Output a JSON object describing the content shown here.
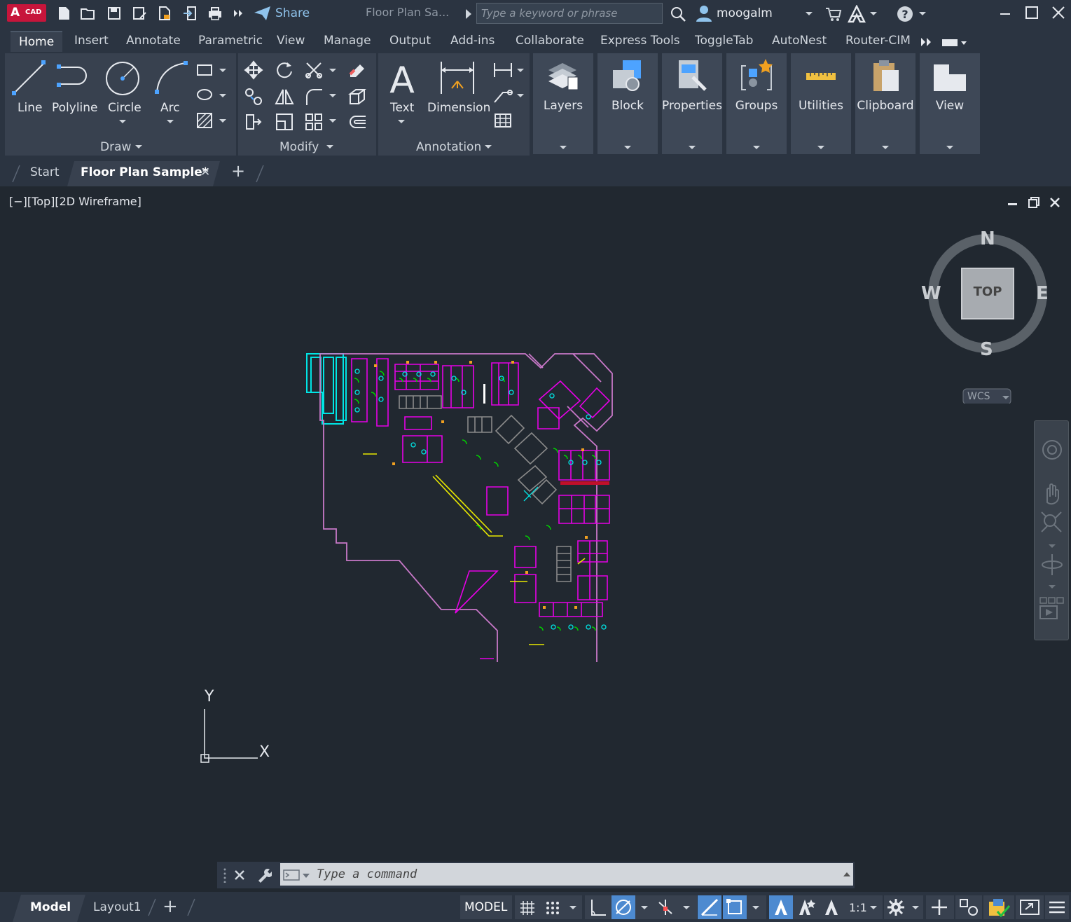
{
  "app": {
    "logo_letter": "A",
    "logo_sub": "CAD"
  },
  "titlebar": {
    "share_label": "Share",
    "document_title": "Floor Plan Sa...",
    "search_placeholder": "Type a keyword or phrase",
    "username": "moogalm"
  },
  "ribbon_tabs": [
    "Home",
    "Insert",
    "Annotate",
    "Parametric",
    "View",
    "Manage",
    "Output",
    "Add-ins",
    "Collaborate",
    "Express Tools",
    "ToggleTab",
    "AutoNest",
    "Router-CIM"
  ],
  "ribbon": {
    "draw": {
      "line": "Line",
      "polyline": "Polyline",
      "circle": "Circle",
      "arc": "Arc",
      "title": "Draw"
    },
    "modify": {
      "title": "Modify"
    },
    "annotation": {
      "text": "Text",
      "dimension": "Dimension",
      "title": "Annotation"
    },
    "big": [
      "Layers",
      "Block",
      "Properties",
      "Groups",
      "Utilities",
      "Clipboard",
      "View"
    ]
  },
  "file_tabs": {
    "start": "Start",
    "active": "Floor Plan Sample*",
    "close": "✕",
    "add": "+"
  },
  "viewport": {
    "label": "[−][Top][2D Wireframe]",
    "viewcube": {
      "n": "N",
      "s": "S",
      "e": "E",
      "w": "W",
      "face": "TOP",
      "wcs": "WCS"
    },
    "ucs": {
      "x": "X",
      "y": "Y"
    }
  },
  "command": {
    "placeholder": "Type a command"
  },
  "layout_tabs": {
    "model": "Model",
    "layout1": "Layout1",
    "add": "+"
  },
  "status": {
    "model": "MODEL",
    "scale": "1:1"
  },
  "colors": {
    "accent": "#4d8ad0",
    "brand": "#c7153b",
    "cyan": "#00e5e5",
    "magenta": "#e600e6",
    "green": "#00d000",
    "yellow": "#e8e800"
  }
}
